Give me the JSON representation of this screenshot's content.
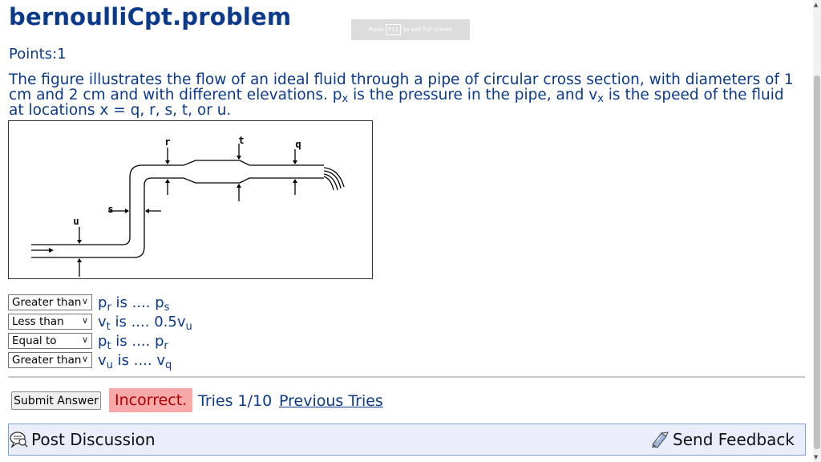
{
  "header": {
    "title": "bernoulliCpt.problem",
    "fullscreen_hint": {
      "pre": "Press",
      "key": "F11",
      "post": "to exit full screen"
    }
  },
  "points_label": "Points:1",
  "question": {
    "part1": "The figure illustrates the flow of an ideal fluid through a pipe of circular cross section, with diameters of 1 cm and 2 cm and with different elevations. p",
    "sub1": "x",
    "part2": " is the pressure in the pipe, and v",
    "sub2": "x",
    "part3": " is the speed of the fluid at locations x = q, r, s, t, or u."
  },
  "figure": {
    "labels": {
      "r": "r",
      "t": "t",
      "q": "q",
      "s": "s",
      "u": "u"
    }
  },
  "answers": [
    {
      "selected": "Greater than",
      "lhs": "p",
      "lhs_sub": "r",
      "mid": " is .... ",
      "rhs": "p",
      "rhs_sub": "s"
    },
    {
      "selected": "Less than",
      "lhs": "v",
      "lhs_sub": "t",
      "mid": " is .... ",
      "rhs": "0.5v",
      "rhs_sub": "u"
    },
    {
      "selected": "Equal to",
      "lhs": "p",
      "lhs_sub": "t",
      "mid": " is .... ",
      "rhs": "p",
      "rhs_sub": "r"
    },
    {
      "selected": "Greater than",
      "lhs": "v",
      "lhs_sub": "u",
      "mid": " is .... ",
      "rhs": "v",
      "rhs_sub": "q"
    }
  ],
  "submit_label": "Submit Answer",
  "status": {
    "text": "Incorrect.",
    "color": "#f7a8a8"
  },
  "tries_text": "Tries 1/10",
  "previous_tries_label": "Previous Tries",
  "bottom": {
    "post_discussion": "Post Discussion",
    "send_feedback": "Send Feedback"
  },
  "colors": {
    "text": "#0b3a8c",
    "incorrect_bg": "#f7a8a8",
    "bar_bg": "#eaeefb"
  }
}
